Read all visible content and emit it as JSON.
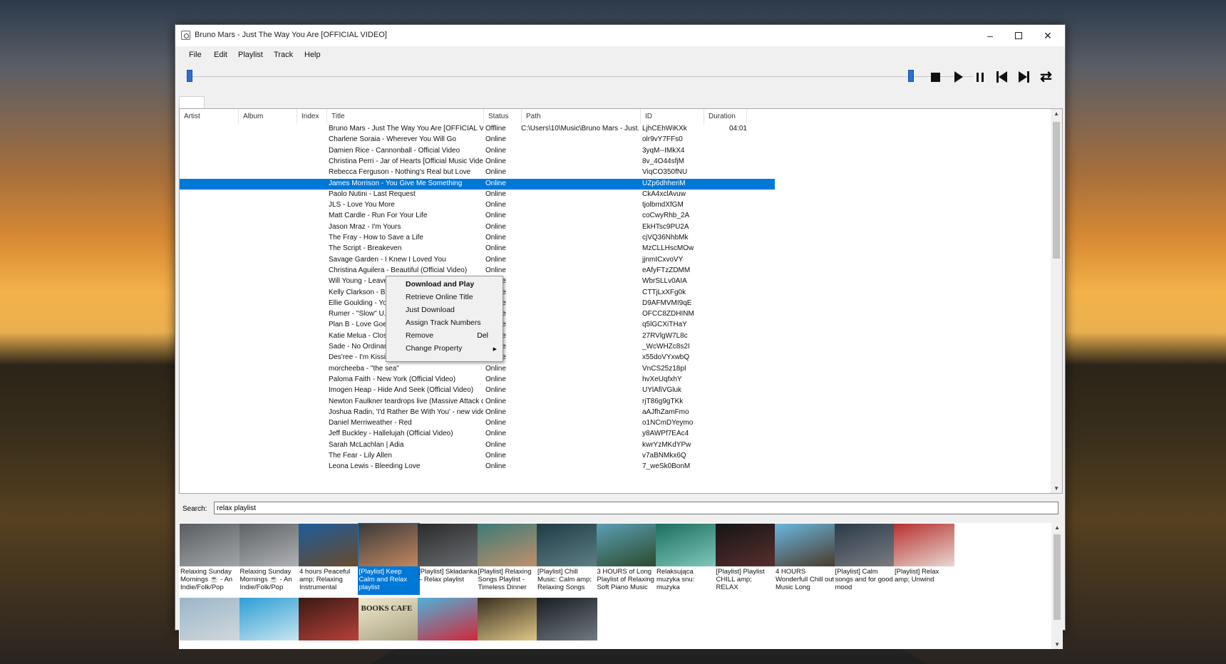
{
  "window": {
    "title": "Bruno Mars - Just The Way You Are [OFFICIAL VIDEO]",
    "minimize_icon": "minimize-icon",
    "maximize_icon": "maximize-icon",
    "close_icon": "close-icon"
  },
  "menu": [
    "File",
    "Edit",
    "Playlist",
    "Track",
    "Help"
  ],
  "player": {
    "seek_fraction": 0.0,
    "volume_fraction": 0.96,
    "accent": "#0078d7"
  },
  "columns": {
    "artist": "Artist",
    "album": "Album",
    "index": "Index",
    "title": "Title",
    "status": "Status",
    "path": "Path",
    "id": "ID",
    "duration": "Duration"
  },
  "tracks": [
    {
      "title": "Bruno Mars - Just The Way You Are [OFFICIAL VIDEO]",
      "status": "Offline",
      "path": "C:\\Users\\10\\Music\\Bruno Mars - Just...",
      "id": "LjhCEhWiKXk",
      "duration": "04:01"
    },
    {
      "title": "Charlene Soraia - Wherever You Will Go",
      "status": "Online",
      "path": "",
      "id": "olr9vY7FFs0",
      "duration": ""
    },
    {
      "title": "Damien Rice - Cannonball - Official Video",
      "status": "Online",
      "path": "",
      "id": "3yqM--IMkX4",
      "duration": ""
    },
    {
      "title": "Christina Perri - Jar of Hearts [Official Music Video]",
      "status": "Online",
      "path": "",
      "id": "8v_4O44sfjM",
      "duration": ""
    },
    {
      "title": "Rebecca Ferguson - Nothing's Real but Love",
      "status": "Online",
      "path": "",
      "id": "ViqCO350fNU",
      "duration": ""
    },
    {
      "title": "James Morrison - You Give Me Something",
      "status": "Online",
      "path": "",
      "id": "UZp6dhheriM",
      "duration": "",
      "selected": true
    },
    {
      "title": "Paolo Nutini - Last Request",
      "status": "Online",
      "path": "",
      "id": "CkA4xclAvuw",
      "duration": ""
    },
    {
      "title": "JLS - Love You More",
      "status": "Online",
      "path": "",
      "id": "tjolbmdXfGM",
      "duration": ""
    },
    {
      "title": "Matt Cardle - Run For Your Life",
      "status": "Online",
      "path": "",
      "id": "coCwyRhb_2A",
      "duration": ""
    },
    {
      "title": "Jason Mraz - I'm Yours",
      "status": "Online",
      "path": "",
      "id": "EkHTsc9PU2A",
      "duration": ""
    },
    {
      "title": "The Fray - How to Save a Life",
      "status": "Online",
      "path": "",
      "id": "cjVQ36NhbMk",
      "duration": ""
    },
    {
      "title": "The Script - Breakeven",
      "status": "Online",
      "path": "",
      "id": "MzCLLHscMOw",
      "duration": ""
    },
    {
      "title": "Savage Garden - I Knew I Loved You",
      "status": "Online",
      "path": "",
      "id": "jjnmICxvoVY",
      "duration": ""
    },
    {
      "title": "Christina Aguilera - Beautiful (Official Video)",
      "status": "Online",
      "path": "",
      "id": "eAfyFTzZDMM",
      "duration": ""
    },
    {
      "title": "Will Young - Leave Right Now",
      "status": "Online",
      "path": "",
      "id": "WbrSLLv0AIA",
      "duration": ""
    },
    {
      "title": "Kelly Clarkson - Because of You (lyrics)",
      "status": "Online",
      "path": "",
      "id": "CTTjLxXFg0k",
      "duration": ""
    },
    {
      "title": "Ellie Goulding - Your Song",
      "status": "Online",
      "path": "",
      "id": "D9AFMVMI9qE",
      "duration": ""
    },
    {
      "title": "Rumer - \"Slow\" U.S. Version  [OFFICIAL]",
      "status": "Online",
      "path": "",
      "id": "OFCC8ZDHINM",
      "duration": ""
    },
    {
      "title": "Plan B - Love Goes Down [OFFICIAL VIDEO]",
      "status": "Online",
      "path": "",
      "id": "q5lGCXiTHaY",
      "duration": ""
    },
    {
      "title": "Katie Melua - Closest Thing To Crazy",
      "status": "Online",
      "path": "",
      "id": "27RVlgW7L8c",
      "duration": ""
    },
    {
      "title": "Sade - No Ordinary Love (Official Video)",
      "status": "Online",
      "path": "",
      "id": "_WcWHZc8s2I",
      "duration": ""
    },
    {
      "title": "Des'ree - I'm Kissing You (Version 1) (Official Video)",
      "status": "Online",
      "path": "",
      "id": "x55doVYxwbQ",
      "duration": ""
    },
    {
      "title": "morcheeba - \"the sea\"",
      "status": "Online",
      "path": "",
      "id": "VnCS25z18pI",
      "duration": ""
    },
    {
      "title": "Paloma Faith - New York (Official Video)",
      "status": "Online",
      "path": "",
      "id": "hvXeUqfxhY",
      "duration": ""
    },
    {
      "title": "Imogen Heap - Hide And Seek (Official Video)",
      "status": "Online",
      "path": "",
      "id": "UYlAfiVGluk",
      "duration": ""
    },
    {
      "title": "Newton Faulkner teardrops live (Massive Attack cover)",
      "status": "Online",
      "path": "",
      "id": "rjT86g9gTKk",
      "duration": ""
    },
    {
      "title": "Joshua Radin, 'I'd Rather Be With You' - new video",
      "status": "Online",
      "path": "",
      "id": "aAJfhZamFmo",
      "duration": ""
    },
    {
      "title": "Daniel Merriweather - Red",
      "status": "Online",
      "path": "",
      "id": "o1NCmDYeymo",
      "duration": ""
    },
    {
      "title": "Jeff Buckley - Hallelujah (Official Video)",
      "status": "Online",
      "path": "",
      "id": "y8AWPf7EAc4",
      "duration": ""
    },
    {
      "title": "Sarah McLachlan | Adia",
      "status": "Online",
      "path": "",
      "id": "kwrYzMKdYPw",
      "duration": ""
    },
    {
      "title": "The Fear - Lily Allen",
      "status": "Online",
      "path": "",
      "id": "v7aBNMkx6Q",
      "duration": ""
    },
    {
      "title": "Leona Lewis - Bleeding Love",
      "status": "Online",
      "path": "",
      "id": "7_weSk0BonM",
      "duration": ""
    }
  ],
  "context_menu": {
    "items": [
      "Download and Play",
      "Retrieve Online Title",
      "Just Download",
      "Assign Track Numbers",
      "Remove",
      "Change Property"
    ],
    "remove_shortcut": "Del"
  },
  "search": {
    "label": "Search:",
    "value": "relax playlist"
  },
  "results": [
    {
      "label": "Relaxing Sunday Mornings ☕ - An Indie/Folk/Pop",
      "c1": "#5a5e62",
      "c2": "#a2a6a8"
    },
    {
      "label": "Relaxing Sunday Mornings ☕ - An Indie/Folk/Pop",
      "c1": "#5e6266",
      "c2": "#b0b2b4"
    },
    {
      "label": "4 hours Peaceful amp; Relaxing Instrumental",
      "c1": "#1d5c9c",
      "c2": "#6a4a2a"
    },
    {
      "label": "[Playlist] Keep Calm and Relax playlist",
      "c1": "#3a3a3a",
      "c2": "#c48860",
      "selected": true
    },
    {
      "label": "[Playlist] Składanka – Relax playlist",
      "c1": "#2a2a2a",
      "c2": "#6a6e72"
    },
    {
      "label": "[Playlist] Relaxing Songs Playlist - Timeless Dinner",
      "c1": "#3c7a78",
      "c2": "#c2906a"
    },
    {
      "label": "[Playlist] Chill Music: Calm amp; Relaxing Songs",
      "c1": "#1e3c46",
      "c2": "#5e7e84"
    },
    {
      "label": "3 HOURS of Long Playlist of Relaxing Soft Piano Music",
      "c1": "#5a9fb4",
      "c2": "#2c4a2c"
    },
    {
      "label": "Relaksująca muzyka snu: muzyka",
      "c1": "#1c6e5e",
      "c2": "#7ec8ba"
    },
    {
      "label": "[Playlist] Playlist CHILL amp; RELAX",
      "c1": "#151515",
      "c2": "#5a2e2e"
    },
    {
      "label": "4 HOURS Wonderfull Chill out Music Long",
      "c1": "#6ab7e0",
      "c2": "#4a3a2a"
    },
    {
      "label": "[Playlist] Calm songs and for good mood",
      "c1": "#2a3a4a",
      "c2": "#7a7c80"
    },
    {
      "label": "[Playlist] Relax amp; Unwind",
      "c1": "#b83030",
      "c2": "#e8d8d0"
    },
    {
      "label": "",
      "c1": "#9bb6c8",
      "c2": "#d0d8dc"
    },
    {
      "label": "",
      "c1": "#2e9ed6",
      "c2": "#c8e6ee"
    },
    {
      "label": "",
      "c1": "#3a1a14",
      "c2": "#b8403a"
    },
    {
      "label": "BOOKS CAFE",
      "c1": "#f0ead0",
      "c2": "#a8a080"
    },
    {
      "label": "",
      "c1": "#50b0d8",
      "c2": "#d02838"
    },
    {
      "label": "",
      "c1": "#3a3020",
      "c2": "#e0c888"
    },
    {
      "label": "",
      "c1": "#1a1e24",
      "c2": "#707880"
    }
  ]
}
